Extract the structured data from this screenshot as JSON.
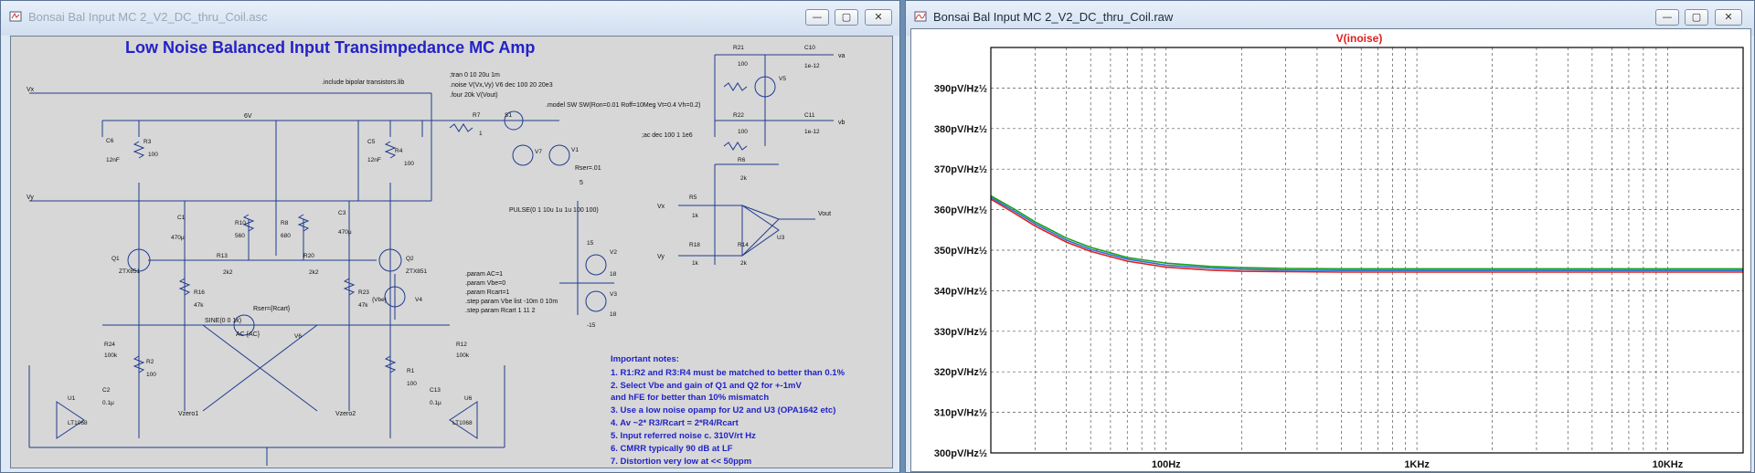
{
  "left_window": {
    "title": "Bonsai Bal Input MC 2_V2_DC_thru_Coil.asc",
    "buttons": {
      "minimize": "—",
      "maximize": "▢",
      "close": "✕"
    }
  },
  "right_window": {
    "title": "Bonsai Bal Input MC 2_V2_DC_thru_Coil.raw",
    "buttons": {
      "minimize": "—",
      "maximize": "▢",
      "close": "✕"
    }
  },
  "schematic": {
    "title": "Low Noise Balanced Input Transimpedance MC Amp",
    "include": ".include bipolar transistors.lib",
    "directives": [
      ";tran 0 10 20u 1m",
      ".noise V(Vx,Vy) V6 dec 100 20 20e3",
      ".four 20k V(Vout)"
    ],
    "model": ".model SW SW(Ron=0.01 Roff=10Meg Vt=0.4 Vh=0.2)",
    "ac_cmd": ";ac dec 100 1 1e6",
    "pulse": "PULSE(0 1 10u 1u 1u 100 100)",
    "params": [
      ".param AC=1",
      ".param Vbe=0",
      ".param Rcart=1",
      ".step param Vbe list -10m 0 10m",
      ".step param Rcart 1 11 2"
    ],
    "sine": "SINE(0 0 1k)",
    "ac_source": "AC {AC}",
    "rser": "Rser={Rcart}",
    "rser2": "Rser=.01",
    "v1_val": "5",
    "nets": {
      "vx": "Vx",
      "vy": "Vy",
      "sixv": "6V",
      "va": "va",
      "vb": "vb",
      "vout": "Vout",
      "vx2": "Vx",
      "vy2": "Vy",
      "vzero1": "Vzero1",
      "vzero2": "Vzero2"
    },
    "parts": {
      "R3": "R3",
      "R3v": "100",
      "C6": "C6",
      "C6v": "12nF",
      "R4": "R4",
      "R4v": "100",
      "C5": "C5",
      "C5v": "12nF",
      "R7": "R7",
      "R7v": "1",
      "S1": "S1",
      "V7": "V7",
      "V1": "V1",
      "R10": "R10",
      "R10v": "560",
      "R8": "R8",
      "R8v": "680",
      "C1": "C1",
      "C1v": "470μ",
      "C3": "C3",
      "C3v": "470μ",
      "Q1": "Q1",
      "Q1m": "ZTX851",
      "Q2": "Q2",
      "Q2m": "ZTX851",
      "R13": "R13",
      "R13v": "2k2",
      "R20": "R20",
      "R20v": "2k2",
      "R16": "R16",
      "R16v": "47k",
      "R23": "R23",
      "R23v": "47k",
      "V4": "V4",
      "Vbe": "{Vbe}",
      "V6": "V6",
      "R24": "R24",
      "R24v": "100k",
      "R12": "R12",
      "R12v": "100k",
      "R2": "R2",
      "R2v": "100",
      "R1": "R1",
      "R1v": "100",
      "C2": "C2",
      "C2v": "0.1μ",
      "C13": "C13",
      "C13v": "0.1μ",
      "U1": "U1",
      "U1m": "LT1068",
      "U6": "U6",
      "U6m": "LT1068",
      "R21": "R21",
      "R21v": "100",
      "C10": "C10",
      "C10v": "1e-12",
      "R22": "R22",
      "R22v": "100",
      "C11": "C11",
      "C11v": "1e-12",
      "V5": "V5",
      "R6": "R6",
      "R6v": "2k",
      "R5": "R5",
      "R5v": "1k",
      "R18": "R18",
      "R18v": "1k",
      "R14": "R14",
      "R14v": "2k",
      "U3": "U3",
      "V2": "V2",
      "V2v": "18",
      "V3": "V3",
      "V3v": "18",
      "p15": "15",
      "m15": "-15"
    },
    "notes_title": "Important notes:",
    "notes": [
      "1. R1:R2 and R3:R4 must be matched to better than 0.1%",
      "2.  Select Vbe and gain of Q1 and Q2 for +-1mV",
      "and hFE for better than 10% mismatch",
      "3. Use a low noise opamp for U2 and U3 (OPA1642 etc)",
      "4. Av ~2* R3/Rcart = 2*R4/Rcart",
      "5. Input referred noise c. 310V/rt Hz",
      "6. CMRR typically 90 dB at LF",
      "7. Distortion very low at << 50ppm"
    ]
  },
  "chart_data": {
    "type": "line",
    "title": "V(inoise)",
    "x_scale": "log",
    "xlim": [
      20,
      20000
    ],
    "ylim": [
      300,
      400
    ],
    "ylabel_unit": "pV/Hz½",
    "y_ticks": [
      {
        "v": 390,
        "label": "390pV/Hz½"
      },
      {
        "v": 380,
        "label": "380pV/Hz½"
      },
      {
        "v": 370,
        "label": "370pV/Hz½"
      },
      {
        "v": 360,
        "label": "360pV/Hz½"
      },
      {
        "v": 350,
        "label": "350pV/Hz½"
      },
      {
        "v": 340,
        "label": "340pV/Hz½"
      },
      {
        "v": 330,
        "label": "330pV/Hz½"
      },
      {
        "v": 320,
        "label": "320pV/Hz½"
      },
      {
        "v": 310,
        "label": "310pV/Hz½"
      },
      {
        "v": 300,
        "label": "300pV/Hz½"
      }
    ],
    "x_ticks": [
      {
        "v": 100,
        "label": "100Hz"
      },
      {
        "v": 1000,
        "label": "1KHz"
      },
      {
        "v": 10000,
        "label": "10KHz"
      }
    ],
    "grid": true,
    "series": [
      {
        "color": "#2b6fd8",
        "x": [
          20,
          25,
          30,
          40,
          50,
          70,
          100,
          150,
          200,
          300,
          500,
          1000,
          2000,
          5000,
          10000,
          20000
        ],
        "y": [
          363,
          359.5,
          356.5,
          352.5,
          350.2,
          347.8,
          346.3,
          345.6,
          345.3,
          345.1,
          345.0,
          345.0,
          345.0,
          345.0,
          345.0,
          345.0
        ]
      },
      {
        "color": "#18a018",
        "x": [
          20,
          25,
          30,
          40,
          50,
          70,
          100,
          150,
          200,
          300,
          500,
          1000,
          2000,
          5000,
          10000,
          20000
        ],
        "y": [
          363.4,
          360,
          357,
          353,
          350.7,
          348.2,
          346.8,
          346.0,
          345.7,
          345.5,
          345.4,
          345.4,
          345.4,
          345.4,
          345.4,
          345.4
        ]
      },
      {
        "color": "#e02020",
        "x": [
          20,
          25,
          30,
          40,
          50,
          70,
          100,
          150,
          200,
          300,
          500,
          1000,
          2000,
          5000,
          10000,
          20000
        ],
        "y": [
          362.6,
          359,
          356,
          352,
          349.7,
          347.3,
          345.8,
          345.1,
          344.8,
          344.7,
          344.6,
          344.6,
          344.6,
          344.6,
          344.6,
          344.6
        ]
      }
    ]
  }
}
